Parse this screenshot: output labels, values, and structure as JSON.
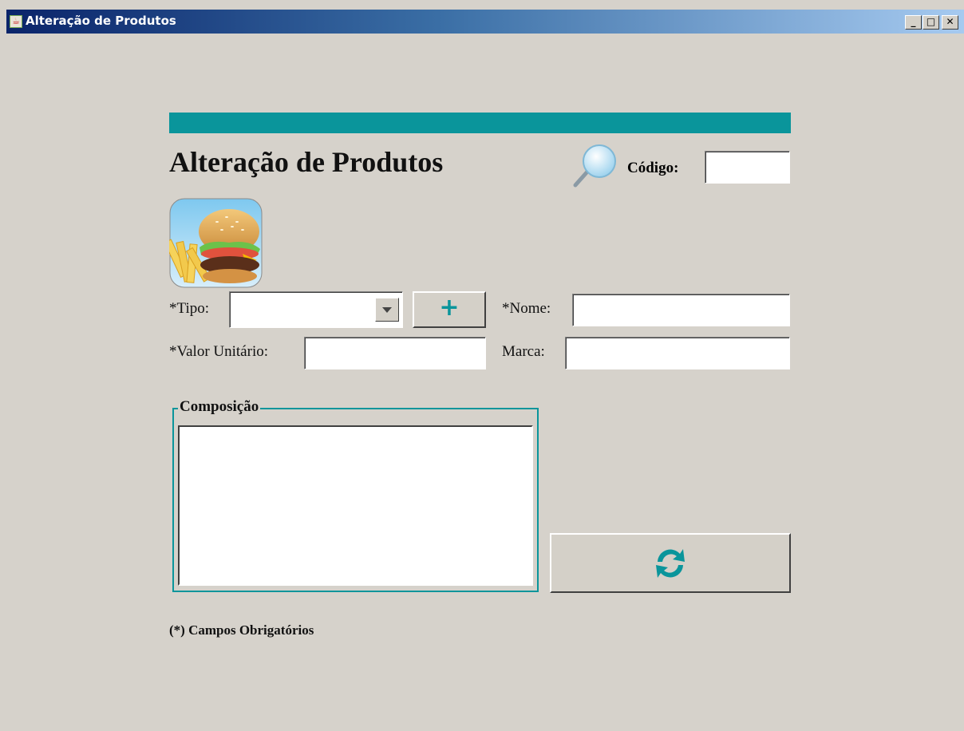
{
  "window": {
    "title": "Alteração de Produtos",
    "icon": "java-cup-icon",
    "minimize": "_",
    "maximize": "□",
    "close": "✕"
  },
  "header": {
    "title": "Alteração de Produtos",
    "search_icon": "search-icon",
    "code_label": "Código:",
    "code_value": ""
  },
  "product_image": "burger-fries-image",
  "form": {
    "tipo_label": "*Tipo:",
    "tipo_value": "",
    "add_button": "+",
    "nome_label": "*Nome:",
    "nome_value": "",
    "valor_label": "*Valor Unitário:",
    "valor_value": "",
    "marca_label": "Marca:",
    "marca_value": ""
  },
  "composicao": {
    "legend": "Composição",
    "value": ""
  },
  "refresh_button": {
    "icon": "refresh-icon"
  },
  "footer": {
    "note": "(*) Campos Obrigatórios"
  },
  "colors": {
    "accent": "#0a959b",
    "background": "#d6d2cb"
  }
}
